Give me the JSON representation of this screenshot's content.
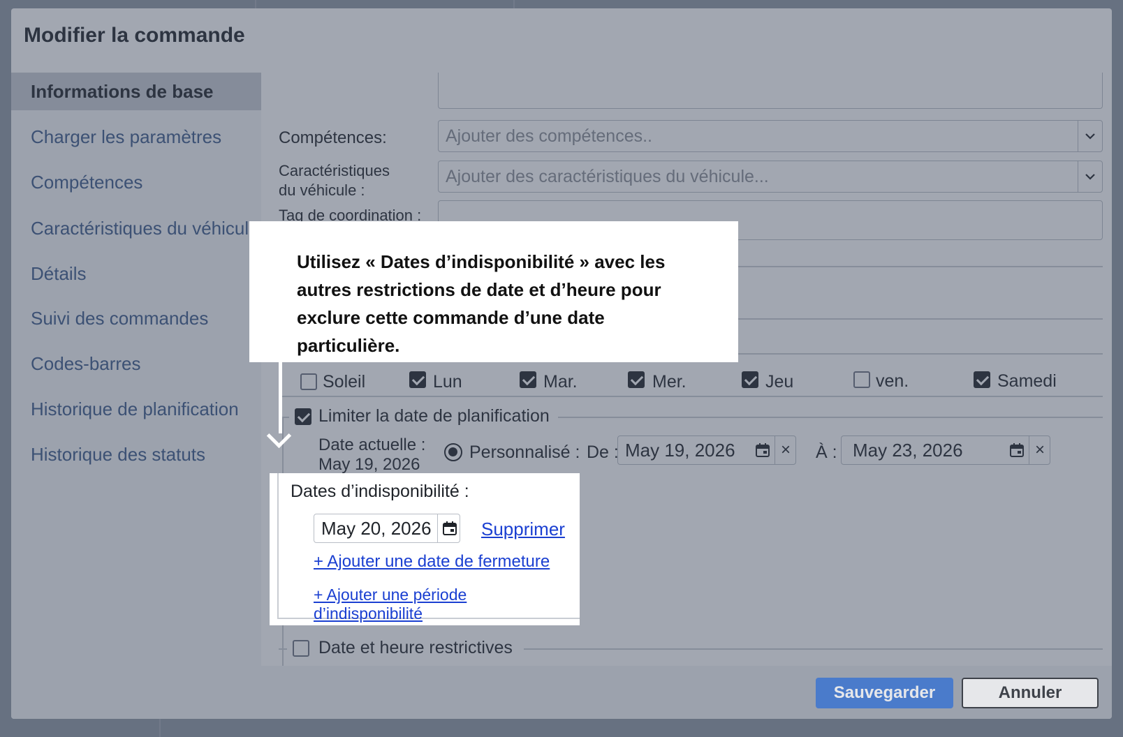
{
  "modal": {
    "title": "Modifier la commande"
  },
  "sidebar": {
    "items": [
      {
        "label": "Informations de base"
      },
      {
        "label": "Charger les paramètres"
      },
      {
        "label": "Compétences"
      },
      {
        "label": "Caractéristiques du véhicule"
      },
      {
        "label": "Détails"
      },
      {
        "label": "Suivi des commandes"
      },
      {
        "label": "Codes-barres"
      },
      {
        "label": "Historique de planification"
      },
      {
        "label": "Historique des statuts"
      }
    ]
  },
  "form": {
    "skills_label": "Compétences:",
    "skills_placeholder": "Ajouter des compétences..",
    "vehicle_label_1": "Caractéristiques",
    "vehicle_label_2": "du véhicule :",
    "vehicle_placeholder": "Ajouter des caractéristiques du véhicule...",
    "coord_label": "Tag de coordination :"
  },
  "days": [
    {
      "label": "Soleil",
      "checked": false
    },
    {
      "label": "Lun",
      "checked": true
    },
    {
      "label": "Mar.",
      "checked": true
    },
    {
      "label": "Mer.",
      "checked": true
    },
    {
      "label": "Jeu",
      "checked": true
    },
    {
      "label": "ven.",
      "checked": false
    },
    {
      "label": "Samedi",
      "checked": true
    }
  ],
  "limit": {
    "label": "Limiter la date de planification",
    "current_label": "Date actuelle :",
    "current_value": "May 19, 2026",
    "custom_label": "Personnalisé :",
    "from_label": "De :",
    "from_value": "May 19, 2026",
    "to_label": "À :",
    "to_value": "May 23, 2026"
  },
  "unavail": {
    "label": "Dates d’indisponibilité :",
    "date_value": "May 20, 2026",
    "delete_label": "Supprimer",
    "add_closure": "+ Ajouter une date de fermeture",
    "add_period": "+ Ajouter une période d’indisponibilité"
  },
  "restrictive": {
    "label": "Date et heure restrictives"
  },
  "tooltip": {
    "text": "Utilisez « Dates d’indisponibilité » avec les autres restrictions de date et d’heure pour exclure cette commande d’une date particulière."
  },
  "footer": {
    "save_label": "Sauvegarder",
    "cancel_label": "Annuler"
  },
  "colors": {
    "primary": "#2f6fd6",
    "link": "#1a3fd1",
    "overlay": "#3c485c"
  }
}
